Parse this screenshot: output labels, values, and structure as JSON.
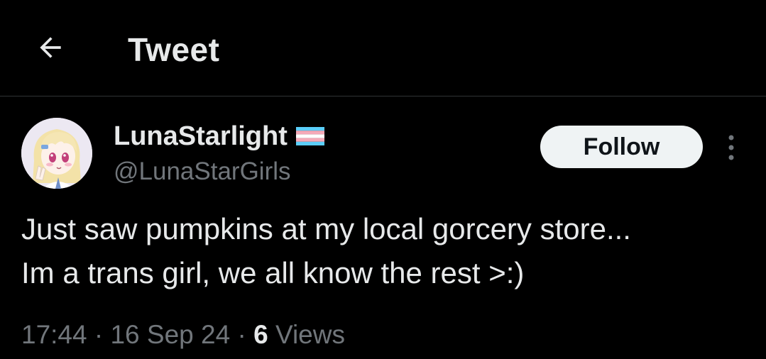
{
  "header": {
    "title": "Tweet",
    "back_icon": "arrow-left-icon"
  },
  "author": {
    "display_name": "LunaStarlight",
    "handle": "@LunaStarGirls",
    "badge_icon": "transgender-flag-icon",
    "avatar_icon": "avatar-icon"
  },
  "actions": {
    "follow_label": "Follow",
    "more_icon": "more-vertical-icon"
  },
  "tweet": {
    "text": "Just saw pumpkins at my local gorcery store...\nIm a trans girl, we all know the rest >:)"
  },
  "meta": {
    "time": "17:44",
    "separator1": " · ",
    "date": "16 Sep 24",
    "separator2": " · ",
    "views_count": "6",
    "views_label": " Views"
  },
  "colors": {
    "background": "#000000",
    "text_primary": "#e7e9ea",
    "text_secondary": "#71767b",
    "follow_bg": "#eff3f4",
    "divider": "#2f3336",
    "flag_blue": "#5bcefa",
    "flag_pink": "#f5a9b8",
    "flag_white": "#ffffff"
  }
}
